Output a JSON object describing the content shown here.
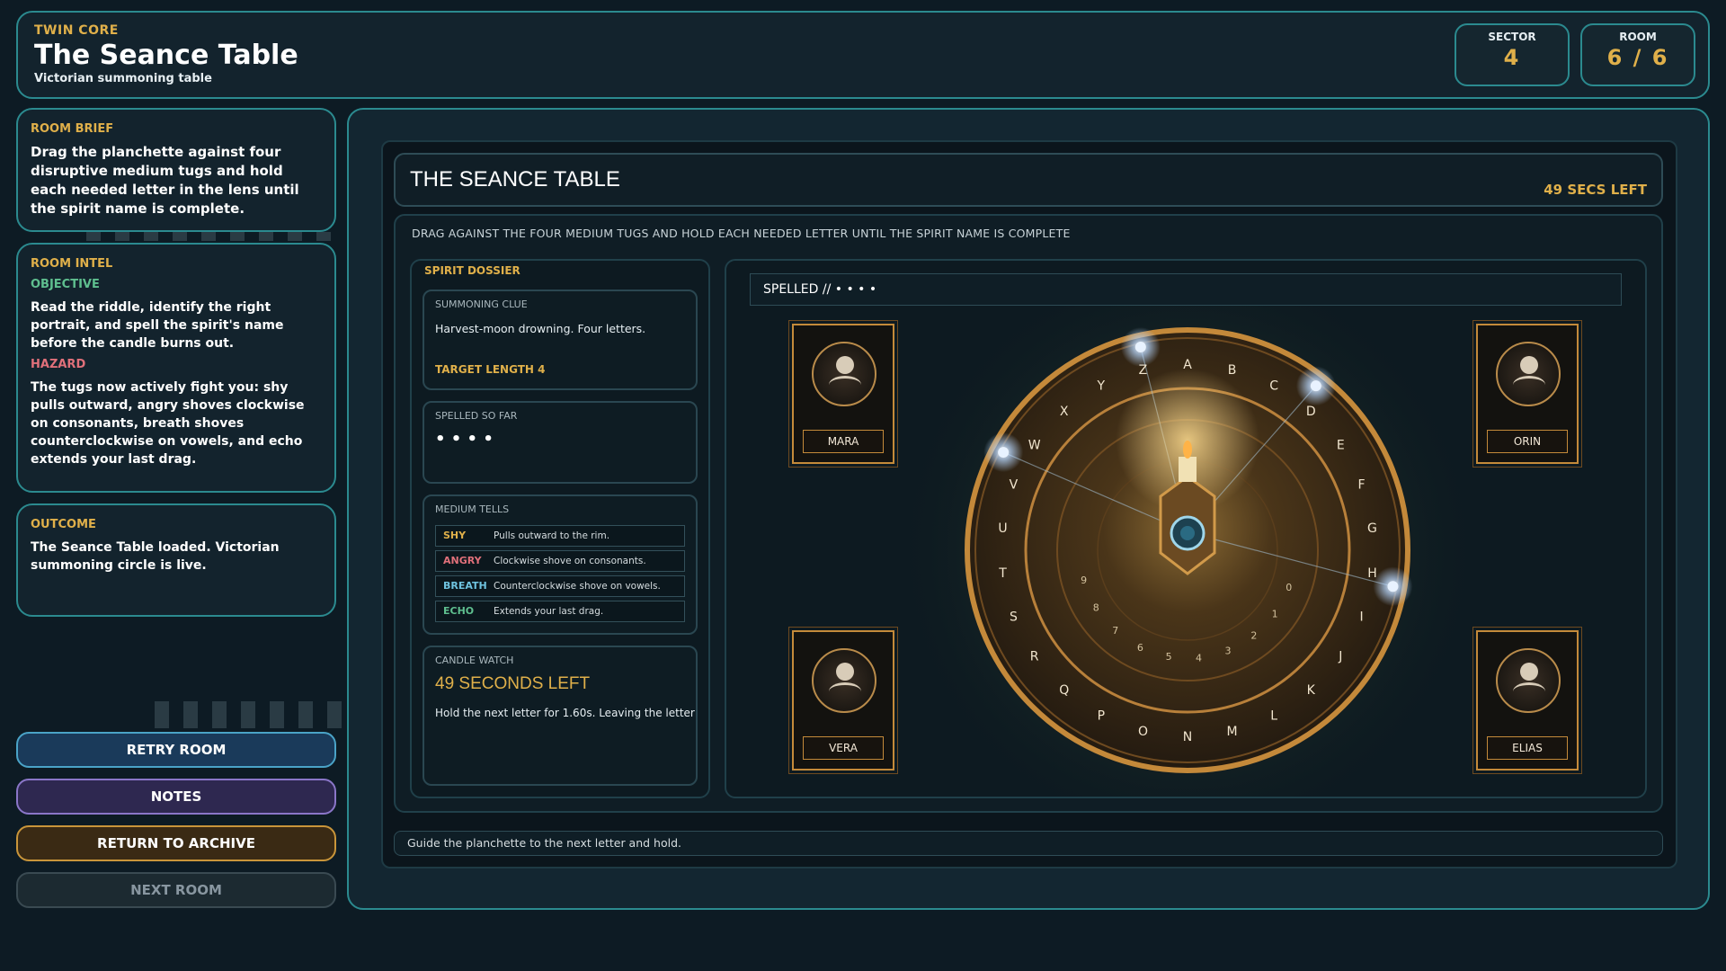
{
  "header": {
    "kicker": "TWIN CORE",
    "title": "The Seance Table",
    "subtitle": "Victorian summoning table",
    "sector_label": "SECTOR",
    "sector_value": "4",
    "room_label": "ROOM",
    "room_value": "6 / 6"
  },
  "sidebar": {
    "brief_heading": "ROOM BRIEF",
    "brief_text": "Drag the planchette against four disruptive medium tugs and hold each needed letter in the lens until the spirit name is complete.",
    "intel_heading": "ROOM INTEL",
    "objective_heading": "OBJECTIVE",
    "objective_text": "Read the riddle, identify the right portrait, and spell the spirit's name before the candle burns out.",
    "hazard_heading": "HAZARD",
    "hazard_text": "The tugs now actively fight you: shy pulls outward, angry shoves clockwise on consonants, breath shoves counterclockwise on vowels, and echo extends your last drag.",
    "outcome_heading": "OUTCOME",
    "outcome_text": "The Seance Table loaded. Victorian summoning circle is live.",
    "buttons": {
      "retry": "RETRY ROOM",
      "notes": "NOTES",
      "return": "RETURN TO ARCHIVE",
      "next": "NEXT ROOM"
    }
  },
  "game": {
    "title": "THE SEANCE TABLE",
    "time_left": "49 SECS LEFT",
    "instruction": "DRAG AGAINST THE FOUR MEDIUM TUGS AND HOLD EACH NEEDED LETTER UNTIL THE SPIRIT NAME IS COMPLETE",
    "spelled_bar": "SPELLED // • • • •",
    "footer": "Guide the planchette to the next letter and hold."
  },
  "dossier": {
    "heading": "SPIRIT DOSSIER",
    "clue_heading": "SUMMONING CLUE",
    "clue_text": "Harvest-moon drowning. Four letters.",
    "target_length": "TARGET LENGTH 4",
    "spelled_heading": "SPELLED SO FAR",
    "spelled_value": "• • • •",
    "tells_heading": "MEDIUM TELLS",
    "tells": [
      {
        "key": "SHY",
        "desc": "Pulls outward to the rim.",
        "color": "#e0b04a"
      },
      {
        "key": "ANGRY",
        "desc": "Clockwise shove on consonants.",
        "color": "#e0707a"
      },
      {
        "key": "BREATH",
        "desc": "Counterclockwise shove on vowels.",
        "color": "#6fc3df"
      },
      {
        "key": "ECHO",
        "desc": "Extends your last drag.",
        "color": "#5fbf8f"
      }
    ],
    "candle_heading": "CANDLE WATCH",
    "candle_value": "49 SECONDS LEFT",
    "candle_text": "Hold the next letter for 1.60s. Leaving the letter"
  },
  "portraits": [
    "MARA",
    "ORIN",
    "VERA",
    "ELIAS"
  ],
  "board": {
    "letters": [
      "A",
      "B",
      "C",
      "D",
      "E",
      "F",
      "G",
      "H",
      "I",
      "J",
      "K",
      "L",
      "M",
      "N",
      "O",
      "P",
      "Q",
      "R",
      "S",
      "T",
      "U",
      "V",
      "W",
      "X",
      "Y",
      "Z"
    ],
    "digits": [
      "0",
      "1",
      "2",
      "3",
      "4",
      "5",
      "6",
      "7",
      "8",
      "9"
    ]
  }
}
